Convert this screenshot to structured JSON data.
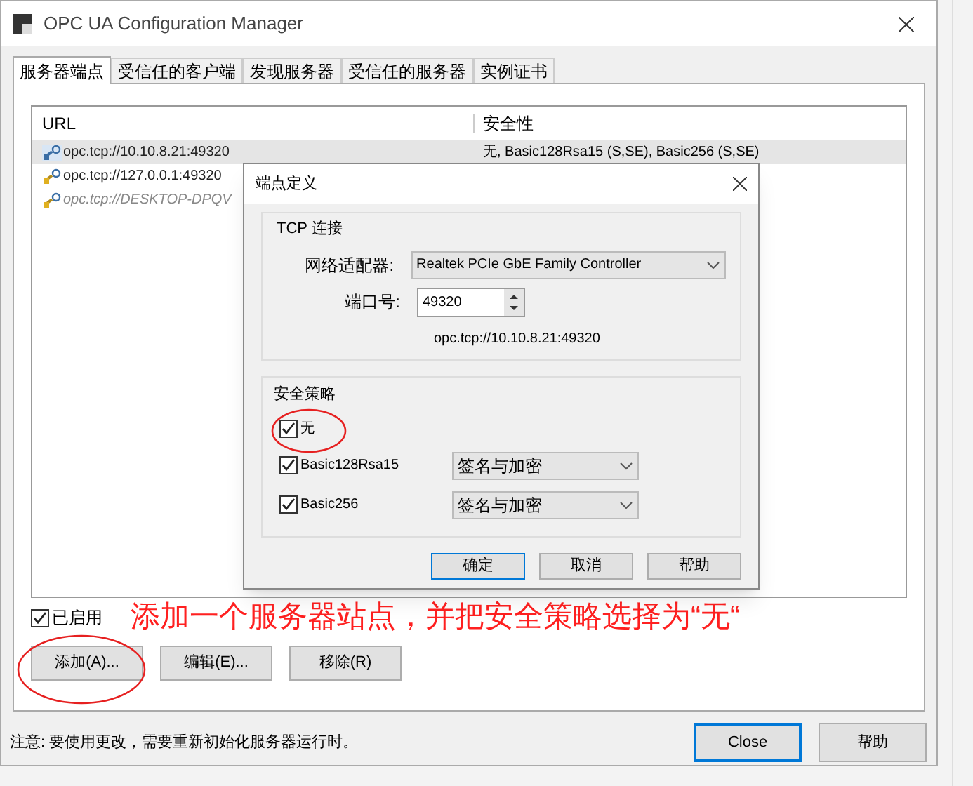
{
  "window": {
    "title": "OPC UA Configuration Manager"
  },
  "tabs": [
    {
      "label": "服务器端点",
      "selected": true
    },
    {
      "label": "受信任的客户端",
      "selected": false
    },
    {
      "label": "发现服务器",
      "selected": false
    },
    {
      "label": "受信任的服务器",
      "selected": false
    },
    {
      "label": "实例证书",
      "selected": false
    }
  ],
  "endpoints": {
    "columns": [
      "URL",
      "安全性"
    ],
    "rows": [
      {
        "url": "opc.tcp://10.10.8.21:49320",
        "security": "无, Basic128Rsa15 (S,SE), Basic256 (S,SE)",
        "selected": true,
        "disabled": false
      },
      {
        "url": "opc.tcp://127.0.0.1:49320",
        "selected": false,
        "disabled": false
      },
      {
        "url": "opc.tcp://DESKTOP-DPQV",
        "selected": false,
        "disabled": true
      }
    ]
  },
  "enabled_checkbox": {
    "label": "已启用",
    "checked": true
  },
  "buttons": [
    "添加(A)...",
    "编辑(E)...",
    "移除(R)"
  ],
  "annotation": "添加一个服务器站点，并把安全策略选择为“无“",
  "note": "注意: 要使用更改，需要重新初始化服务器运行时。",
  "footer_buttons": [
    {
      "label": "Close",
      "default": true
    },
    {
      "label": "帮助",
      "default": false
    }
  ],
  "dialog": {
    "title": "端点定义",
    "tcp_group": {
      "title": "TCP 连接",
      "adapter_label": "网络适配器:",
      "adapter_value": "Realtek PCIe GbE Family Controller",
      "port_label": "端口号:",
      "port_value": "49320",
      "url": "opc.tcp://10.10.8.21:49320"
    },
    "security_group": {
      "title": "安全策略",
      "policies": [
        {
          "label": "无",
          "checked": true,
          "circled": true
        },
        {
          "label": "Basic128Rsa15",
          "checked": true,
          "mode": "签名与加密",
          "circled": false
        },
        {
          "label": "Basic256",
          "checked": true,
          "mode": "签名与加密",
          "circled": false
        }
      ]
    },
    "buttons": [
      {
        "label": "确定",
        "default": true
      },
      {
        "label": "取消",
        "default": false
      },
      {
        "label": "帮助",
        "default": false
      }
    ]
  }
}
